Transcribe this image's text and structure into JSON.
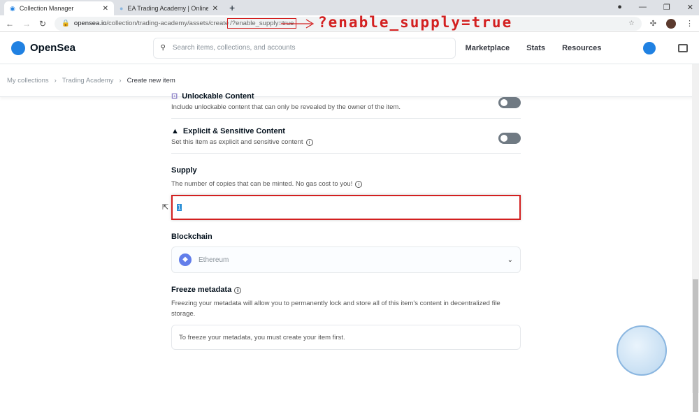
{
  "browser": {
    "tabs": [
      {
        "title": "Collection Manager",
        "active": true
      },
      {
        "title": "EA Trading Academy | Online Co",
        "active": false
      }
    ],
    "url_domain": "opensea.io",
    "url_path": "/collection/trading-academy/assets/create",
    "url_query": "/?enable_supply=true",
    "annotation": "?enable_supply=true",
    "annotation_color": "#d32020"
  },
  "nav": {
    "logo": "OpenSea",
    "search_placeholder": "Search items, collections, and accounts",
    "links": [
      "Marketplace",
      "Stats",
      "Resources"
    ],
    "accent": "#2081e2"
  },
  "breadcrumb": [
    "My collections",
    "Trading Academy",
    "Create new item"
  ],
  "form": {
    "unlockable": {
      "title": "Unlockable Content",
      "desc": "Include unlockable content that can only be revealed by the owner of the item.",
      "enabled": false
    },
    "explicit": {
      "title": "Explicit & Sensitive Content",
      "desc": "Set this item as explicit and sensitive content",
      "enabled": false
    },
    "supply": {
      "title": "Supply",
      "desc": "The number of copies that can be minted. No gas cost to you!",
      "value": "1"
    },
    "blockchain": {
      "title": "Blockchain",
      "value": "Ethereum"
    },
    "freeze": {
      "title": "Freeze metadata",
      "desc": "Freezing your metadata will allow you to permanently lock and store all of this item's content in decentralized file storage.",
      "note": "To freeze your metadata, you must create your item first."
    }
  }
}
